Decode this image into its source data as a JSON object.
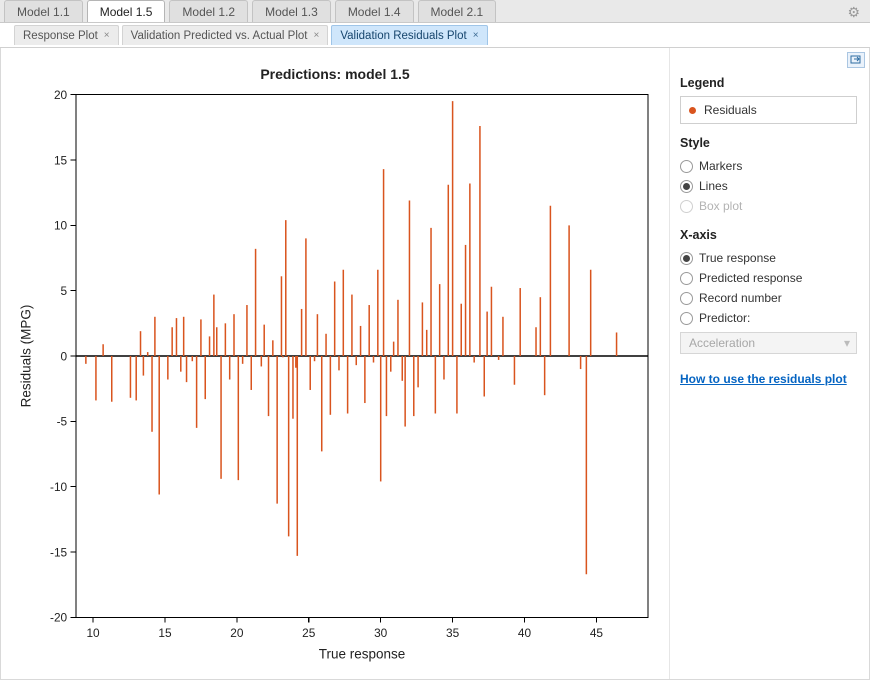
{
  "model_tabs": {
    "items": [
      {
        "label": "Model 1.1",
        "active": false
      },
      {
        "label": "Model 1.5",
        "active": true
      },
      {
        "label": "Model 1.2",
        "active": false
      },
      {
        "label": "Model 1.3",
        "active": false
      },
      {
        "label": "Model 1.4",
        "active": false
      },
      {
        "label": "Model 2.1",
        "active": false
      }
    ]
  },
  "plot_tabs": {
    "items": [
      {
        "label": "Response Plot",
        "active": false
      },
      {
        "label": "Validation Predicted vs. Actual Plot",
        "active": false
      },
      {
        "label": "Validation Residuals Plot",
        "active": true
      }
    ]
  },
  "side": {
    "legend_head": "Legend",
    "legend_item": "Residuals",
    "style_head": "Style",
    "style_opts": [
      "Markers",
      "Lines",
      "Box plot"
    ],
    "style_sel": "Lines",
    "style_disabled": [
      "Box plot"
    ],
    "xaxis_head": "X-axis",
    "xaxis_opts": [
      "True response",
      "Predicted response",
      "Record number",
      "Predictor:"
    ],
    "xaxis_sel": "True response",
    "predictor_sel": "Acceleration",
    "help_link": "How to use the residuals plot"
  },
  "chart_data": {
    "type": "bar",
    "title": "Predictions: model 1.5",
    "xlabel": "True response",
    "ylabel": "Residuals (MPG)",
    "xlim": [
      8.8,
      48.6
    ],
    "ylim": [
      -20,
      20
    ],
    "xticks": [
      10,
      15,
      20,
      25,
      30,
      35,
      40,
      45
    ],
    "yticks": [
      -20,
      -15,
      -10,
      -5,
      0,
      5,
      10,
      15,
      20
    ],
    "series": [
      {
        "name": "Residuals",
        "color": "#d9541e"
      }
    ],
    "data": [
      {
        "x": 9.5,
        "y": -0.6
      },
      {
        "x": 10.2,
        "y": -3.4
      },
      {
        "x": 10.7,
        "y": 0.9
      },
      {
        "x": 11.3,
        "y": -3.5
      },
      {
        "x": 12.6,
        "y": -3.2
      },
      {
        "x": 13.0,
        "y": -3.4
      },
      {
        "x": 13.3,
        "y": 1.9
      },
      {
        "x": 13.5,
        "y": -1.5
      },
      {
        "x": 13.8,
        "y": 0.3
      },
      {
        "x": 14.1,
        "y": -5.8
      },
      {
        "x": 14.3,
        "y": 3.0
      },
      {
        "x": 14.6,
        "y": -10.6
      },
      {
        "x": 15.2,
        "y": -1.8
      },
      {
        "x": 15.5,
        "y": 2.2
      },
      {
        "x": 15.8,
        "y": 2.9
      },
      {
        "x": 16.1,
        "y": -1.2
      },
      {
        "x": 16.3,
        "y": 3.0
      },
      {
        "x": 16.5,
        "y": -2.0
      },
      {
        "x": 16.9,
        "y": -0.4
      },
      {
        "x": 17.2,
        "y": -5.5
      },
      {
        "x": 17.5,
        "y": 2.8
      },
      {
        "x": 17.8,
        "y": -3.3
      },
      {
        "x": 18.1,
        "y": 1.5
      },
      {
        "x": 18.4,
        "y": 4.7
      },
      {
        "x": 18.6,
        "y": 2.2
      },
      {
        "x": 18.9,
        "y": -9.4
      },
      {
        "x": 19.2,
        "y": 2.5
      },
      {
        "x": 19.5,
        "y": -1.8
      },
      {
        "x": 19.8,
        "y": 3.2
      },
      {
        "x": 20.1,
        "y": -9.5
      },
      {
        "x": 20.4,
        "y": -0.6
      },
      {
        "x": 20.7,
        "y": 3.9
      },
      {
        "x": 21.0,
        "y": -2.6
      },
      {
        "x": 21.3,
        "y": 8.2
      },
      {
        "x": 21.7,
        "y": -0.8
      },
      {
        "x": 21.9,
        "y": 2.4
      },
      {
        "x": 22.2,
        "y": -4.6
      },
      {
        "x": 22.5,
        "y": 1.2
      },
      {
        "x": 22.8,
        "y": -11.3
      },
      {
        "x": 23.1,
        "y": 6.1
      },
      {
        "x": 23.2,
        "y": -0.1
      },
      {
        "x": 23.4,
        "y": 10.4
      },
      {
        "x": 23.6,
        "y": -13.8
      },
      {
        "x": 23.9,
        "y": -4.8
      },
      {
        "x": 24.1,
        "y": -0.9
      },
      {
        "x": 24.2,
        "y": -15.3
      },
      {
        "x": 24.5,
        "y": 3.6
      },
      {
        "x": 24.8,
        "y": 9.0
      },
      {
        "x": 25.1,
        "y": -2.6
      },
      {
        "x": 25.4,
        "y": -0.4
      },
      {
        "x": 25.6,
        "y": 3.2
      },
      {
        "x": 25.9,
        "y": -7.3
      },
      {
        "x": 26.2,
        "y": 1.7
      },
      {
        "x": 26.5,
        "y": -4.5
      },
      {
        "x": 26.8,
        "y": 5.7
      },
      {
        "x": 27.1,
        "y": -1.1
      },
      {
        "x": 27.4,
        "y": 6.6
      },
      {
        "x": 27.7,
        "y": -4.4
      },
      {
        "x": 28.0,
        "y": 4.7
      },
      {
        "x": 28.3,
        "y": -0.7
      },
      {
        "x": 28.6,
        "y": 2.3
      },
      {
        "x": 28.9,
        "y": -3.6
      },
      {
        "x": 29.2,
        "y": 3.9
      },
      {
        "x": 29.5,
        "y": -0.5
      },
      {
        "x": 29.8,
        "y": 6.6
      },
      {
        "x": 30.0,
        "y": -9.6
      },
      {
        "x": 30.2,
        "y": 14.3
      },
      {
        "x": 30.4,
        "y": -4.6
      },
      {
        "x": 30.7,
        "y": -1.2
      },
      {
        "x": 30.9,
        "y": 1.1
      },
      {
        "x": 31.2,
        "y": 4.3
      },
      {
        "x": 31.5,
        "y": -1.9
      },
      {
        "x": 31.7,
        "y": -5.4
      },
      {
        "x": 32.0,
        "y": 11.9
      },
      {
        "x": 32.3,
        "y": -4.6
      },
      {
        "x": 32.6,
        "y": -2.4
      },
      {
        "x": 32.9,
        "y": 4.1
      },
      {
        "x": 33.2,
        "y": 2.0
      },
      {
        "x": 33.5,
        "y": 9.8
      },
      {
        "x": 33.8,
        "y": -4.4
      },
      {
        "x": 34.1,
        "y": 5.5
      },
      {
        "x": 34.4,
        "y": -1.8
      },
      {
        "x": 34.7,
        "y": 13.1
      },
      {
        "x": 35.0,
        "y": 19.5
      },
      {
        "x": 35.3,
        "y": -4.4
      },
      {
        "x": 35.6,
        "y": 4.0
      },
      {
        "x": 35.9,
        "y": 8.5
      },
      {
        "x": 36.2,
        "y": 13.2
      },
      {
        "x": 36.5,
        "y": -0.5
      },
      {
        "x": 36.9,
        "y": 17.6
      },
      {
        "x": 37.2,
        "y": -3.1
      },
      {
        "x": 37.4,
        "y": 3.4
      },
      {
        "x": 37.7,
        "y": 5.3
      },
      {
        "x": 38.2,
        "y": -0.3
      },
      {
        "x": 38.5,
        "y": 3.0
      },
      {
        "x": 39.3,
        "y": -2.2
      },
      {
        "x": 39.7,
        "y": 5.2
      },
      {
        "x": 40.8,
        "y": 2.2
      },
      {
        "x": 41.1,
        "y": 4.5
      },
      {
        "x": 41.4,
        "y": -3.0
      },
      {
        "x": 41.8,
        "y": 11.5
      },
      {
        "x": 43.1,
        "y": 10.0
      },
      {
        "x": 43.9,
        "y": -1.0
      },
      {
        "x": 44.3,
        "y": -16.7
      },
      {
        "x": 44.6,
        "y": 6.6
      },
      {
        "x": 46.4,
        "y": 1.8
      }
    ]
  }
}
